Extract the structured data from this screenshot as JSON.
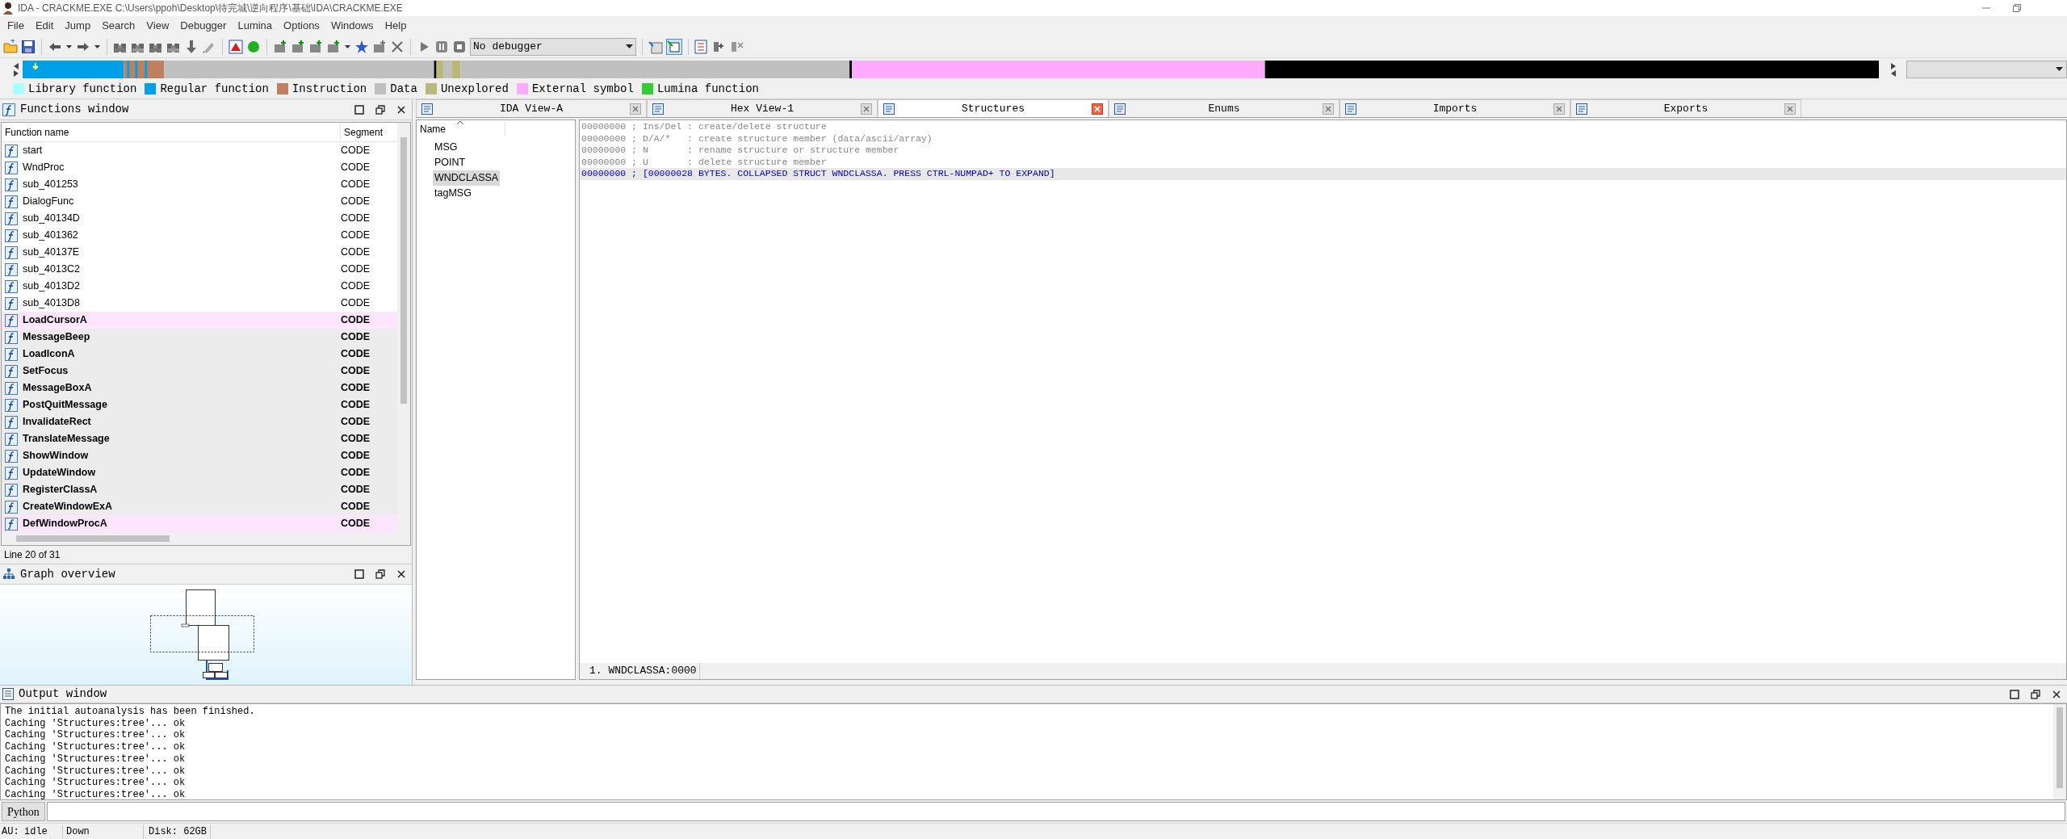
{
  "window": {
    "title": "IDA - CRACKME.EXE C:\\Users\\ppoh\\Desktop\\待完城\\逆向程序\\基础\\IDA\\CRACKME.EXE"
  },
  "menu": [
    "File",
    "Edit",
    "Jump",
    "Search",
    "View",
    "Debugger",
    "Lumina",
    "Options",
    "Windows",
    "Help"
  ],
  "toolbar": {
    "debugger_select": "No debugger"
  },
  "legend": [
    {
      "label": "Library function",
      "color": "#aaffff"
    },
    {
      "label": "Regular function",
      "color": "#00a0e8"
    },
    {
      "label": "Instruction",
      "color": "#c08060"
    },
    {
      "label": "Data",
      "color": "#c0c0c0"
    },
    {
      "label": "Unexplored",
      "color": "#b8b878"
    },
    {
      "label": "External symbol",
      "color": "#ffaaff"
    },
    {
      "label": "Lumina function",
      "color": "#33cc33"
    }
  ],
  "functions_window": {
    "title": "Functions window",
    "columns": [
      "Function name",
      "Segment"
    ],
    "rows": [
      {
        "name": "start",
        "segment": "CODE",
        "kind": "local",
        "selected": false
      },
      {
        "name": "WndProc",
        "segment": "CODE",
        "kind": "local",
        "selected": false
      },
      {
        "name": "sub_401253",
        "segment": "CODE",
        "kind": "local",
        "selected": false
      },
      {
        "name": "DialogFunc",
        "segment": "CODE",
        "kind": "local",
        "selected": false
      },
      {
        "name": "sub_40134D",
        "segment": "CODE",
        "kind": "local",
        "selected": false
      },
      {
        "name": "sub_401362",
        "segment": "CODE",
        "kind": "local",
        "selected": false
      },
      {
        "name": "sub_40137E",
        "segment": "CODE",
        "kind": "local",
        "selected": false
      },
      {
        "name": "sub_4013C2",
        "segment": "CODE",
        "kind": "local",
        "selected": false
      },
      {
        "name": "sub_4013D2",
        "segment": "CODE",
        "kind": "local",
        "selected": false
      },
      {
        "name": "sub_4013D8",
        "segment": "CODE",
        "kind": "local",
        "selected": false
      },
      {
        "name": "LoadCursorA",
        "segment": "CODE",
        "kind": "import",
        "selected": false
      },
      {
        "name": "MessageBeep",
        "segment": "CODE",
        "kind": "import",
        "selected": true
      },
      {
        "name": "LoadIconA",
        "segment": "CODE",
        "kind": "import",
        "selected": true
      },
      {
        "name": "SetFocus",
        "segment": "CODE",
        "kind": "import",
        "selected": true
      },
      {
        "name": "MessageBoxA",
        "segment": "CODE",
        "kind": "import",
        "selected": true
      },
      {
        "name": "PostQuitMessage",
        "segment": "CODE",
        "kind": "import",
        "selected": true
      },
      {
        "name": "InvalidateRect",
        "segment": "CODE",
        "kind": "import",
        "selected": true
      },
      {
        "name": "TranslateMessage",
        "segment": "CODE",
        "kind": "import",
        "selected": true
      },
      {
        "name": "ShowWindow",
        "segment": "CODE",
        "kind": "import",
        "selected": true
      },
      {
        "name": "UpdateWindow",
        "segment": "CODE",
        "kind": "import",
        "selected": true
      },
      {
        "name": "RegisterClassA",
        "segment": "CODE",
        "kind": "import",
        "selected": true
      },
      {
        "name": "CreateWindowExA",
        "segment": "CODE",
        "kind": "import",
        "selected": true
      },
      {
        "name": "DefWindowProcA",
        "segment": "CODE",
        "kind": "import",
        "selected": false
      }
    ],
    "status": "Line 20 of 31"
  },
  "graph_overview": {
    "title": "Graph overview"
  },
  "tabs": [
    {
      "label": "IDA View-A",
      "selected": false
    },
    {
      "label": "Hex View-1",
      "selected": false
    },
    {
      "label": "Structures",
      "selected": true
    },
    {
      "label": "Enums",
      "selected": false
    },
    {
      "label": "Imports",
      "selected": false
    },
    {
      "label": "Exports",
      "selected": false
    }
  ],
  "structures": {
    "tree_header": "Name",
    "items": [
      {
        "label": "MSG",
        "selected": false
      },
      {
        "label": "POINT",
        "selected": false
      },
      {
        "label": "WNDCLASSA",
        "selected": true
      },
      {
        "label": "tagMSG",
        "selected": false
      }
    ],
    "lines": [
      {
        "text": "00000000 ; Ins/Del : create/delete structure",
        "kind": "comment",
        "current": false
      },
      {
        "text": "00000000 ; D/A/*   : create structure member (data/ascii/array)",
        "kind": "comment",
        "current": false
      },
      {
        "text": "00000000 ; N       : rename structure or structure member",
        "kind": "comment",
        "current": false
      },
      {
        "text": "00000000 ; U       : delete structure member",
        "kind": "comment",
        "current": false
      },
      {
        "text": "00000000 ; [00000028 BYTES. COLLAPSED STRUCT WNDCLASSA. PRESS CTRL-NUMPAD+ TO EXPAND]",
        "kind": "collapsed",
        "current": true
      }
    ],
    "location": "1. WNDCLASSA:0000"
  },
  "output": {
    "title": "Output window",
    "lines": [
      "The initial autoanalysis has been finished.",
      "Caching 'Structures:tree'... ok",
      "Caching 'Structures:tree'... ok",
      "Caching 'Structures:tree'... ok",
      "Caching 'Structures:tree'... ok",
      "Caching 'Structures:tree'... ok",
      "Caching 'Structures:tree'... ok",
      "Caching 'Structures:tree'... ok"
    ],
    "python_button": "Python"
  },
  "status_bar": [
    "AU:",
    "idle",
    "Down",
    "Disk: 62GB"
  ]
}
